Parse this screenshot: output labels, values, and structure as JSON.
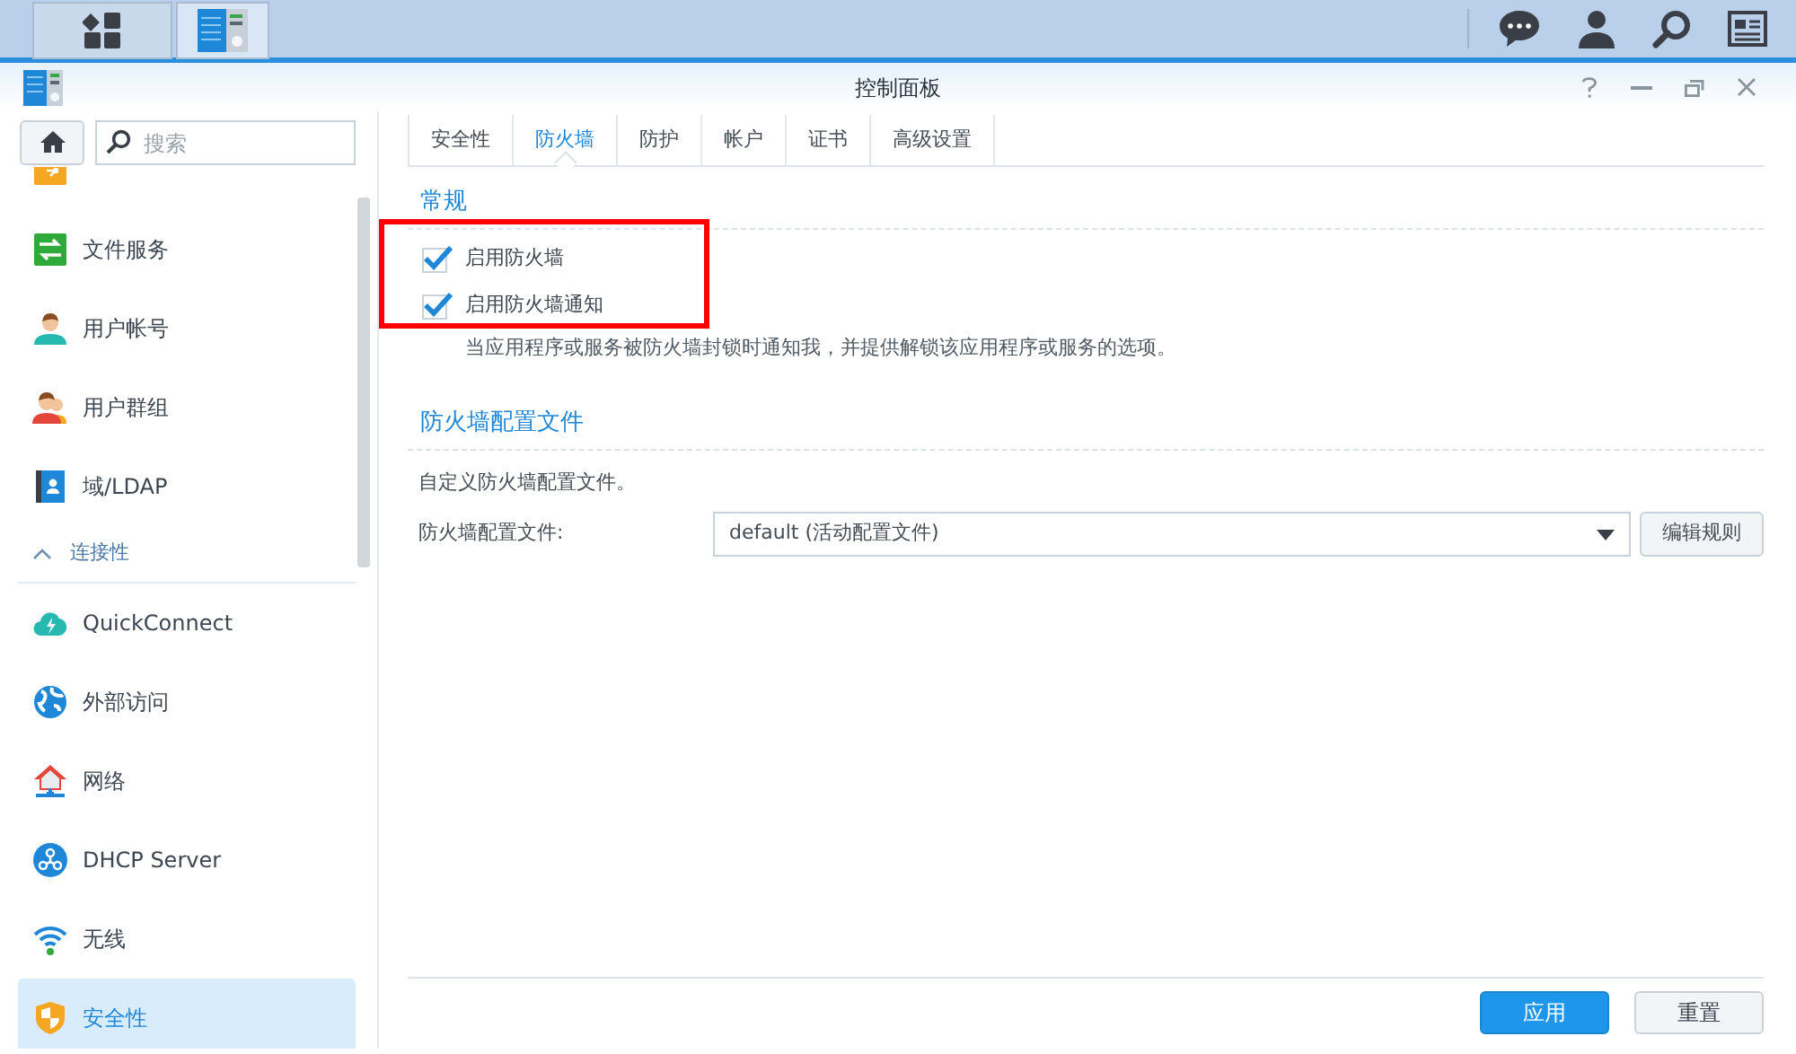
{
  "taskbar": {
    "apps": [
      {
        "selected": false
      },
      {
        "selected": true
      }
    ]
  },
  "window": {
    "title": "控制面板"
  },
  "sidebar": {
    "search": {
      "placeholder": "搜索"
    },
    "items": [
      {
        "kind": "item",
        "selected": false
      },
      {
        "kind": "item",
        "label": "文件服务",
        "selected": false
      },
      {
        "kind": "item",
        "label": "用户帐号",
        "selected": false
      },
      {
        "kind": "item",
        "label": "用户群组",
        "selected": false
      },
      {
        "kind": "item",
        "label": "域/LDAP",
        "selected": false
      },
      {
        "kind": "section",
        "label": "连接性",
        "expanded": true
      },
      {
        "kind": "item",
        "label": "QuickConnect",
        "selected": false
      },
      {
        "kind": "item",
        "label": "外部访问",
        "selected": false
      },
      {
        "kind": "item",
        "label": "网络",
        "selected": false
      },
      {
        "kind": "item",
        "label": "DHCP Server",
        "selected": false
      },
      {
        "kind": "item",
        "label": "无线",
        "selected": false
      },
      {
        "kind": "item",
        "label": "安全性",
        "selected": true
      }
    ]
  },
  "tabs": [
    {
      "label": "安全性",
      "selected": false
    },
    {
      "label": "防火墙",
      "selected": true
    },
    {
      "label": "防护",
      "selected": false
    },
    {
      "label": "帐户",
      "selected": false
    },
    {
      "label": "证书",
      "selected": false
    },
    {
      "label": "高级设置",
      "selected": false
    }
  ],
  "general": {
    "title": "常规",
    "options": [
      {
        "label": "启用防火墙",
        "checked": true
      },
      {
        "label": "启用防火墙通知",
        "checked": true
      }
    ],
    "note": "当应用程序或服务被防火墙封锁时通知我，并提供解锁该应用程序或服务的选项。"
  },
  "profile": {
    "title": "防火墙配置文件",
    "description": "自定义防火墙配置文件。",
    "field_label": "防火墙配置文件:",
    "select": {
      "value": "default (活动配置文件)"
    },
    "button": "编辑规则"
  },
  "footer": {
    "buttons": [
      {
        "label": "应用",
        "kind": "primary"
      },
      {
        "label": "重置",
        "kind": "secondary"
      }
    ]
  }
}
